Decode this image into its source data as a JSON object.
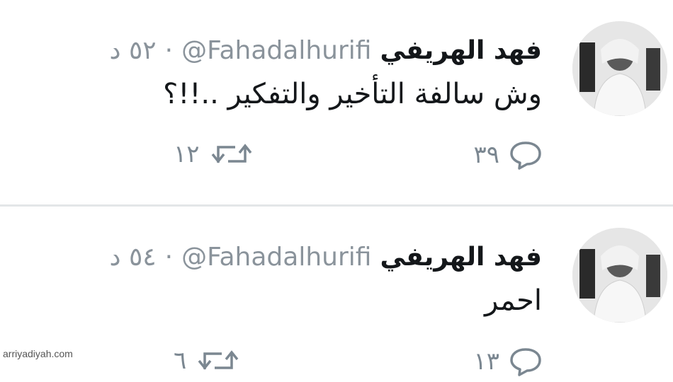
{
  "tweets": [
    {
      "name": "فهد الهريفي",
      "handle": "@Fahadalhurifi",
      "separator": "·",
      "time": "٥٢ د",
      "text": "وش سالفة التأخير والتفكير ..!!؟",
      "replies": "٣٩",
      "retweets": "١٢"
    },
    {
      "name": "فهد الهريفي",
      "handle": "@Fahadalhurifi",
      "separator": "·",
      "time": "٥٤ د",
      "text": "احمر",
      "replies": "١٣",
      "retweets": "٦"
    }
  ],
  "icons": {
    "reply": "reply-icon",
    "retweet": "retweet-icon"
  },
  "watermark": "arriyadiyah.com",
  "colors": {
    "text": "#14171a",
    "muted": "#8a939b",
    "divider": "#e3e6e8"
  }
}
